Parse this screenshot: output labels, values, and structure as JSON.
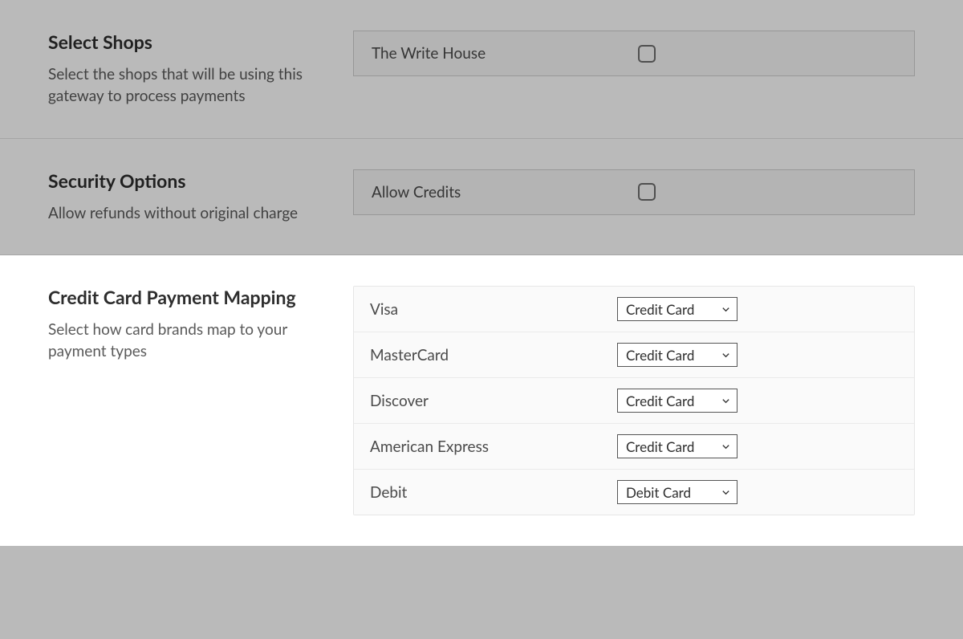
{
  "sections": {
    "select_shops": {
      "title": "Select Shops",
      "description": "Select the shops that will be using this gateway to process payments",
      "options": [
        {
          "label": "The Write House",
          "checked": false
        }
      ]
    },
    "security_options": {
      "title": "Security Options",
      "description": "Allow refunds without original charge",
      "options": [
        {
          "label": "Allow Credits",
          "checked": false
        }
      ]
    },
    "card_mapping": {
      "title": "Credit Card Payment Mapping",
      "description": "Select how card brands map to your payment types",
      "rows": [
        {
          "brand": "Visa",
          "mapped_to": "Credit Card"
        },
        {
          "brand": "MasterCard",
          "mapped_to": "Credit Card"
        },
        {
          "brand": "Discover",
          "mapped_to": "Credit Card"
        },
        {
          "brand": "American Express",
          "mapped_to": "Credit Card"
        },
        {
          "brand": "Debit",
          "mapped_to": "Debit Card"
        }
      ]
    }
  }
}
